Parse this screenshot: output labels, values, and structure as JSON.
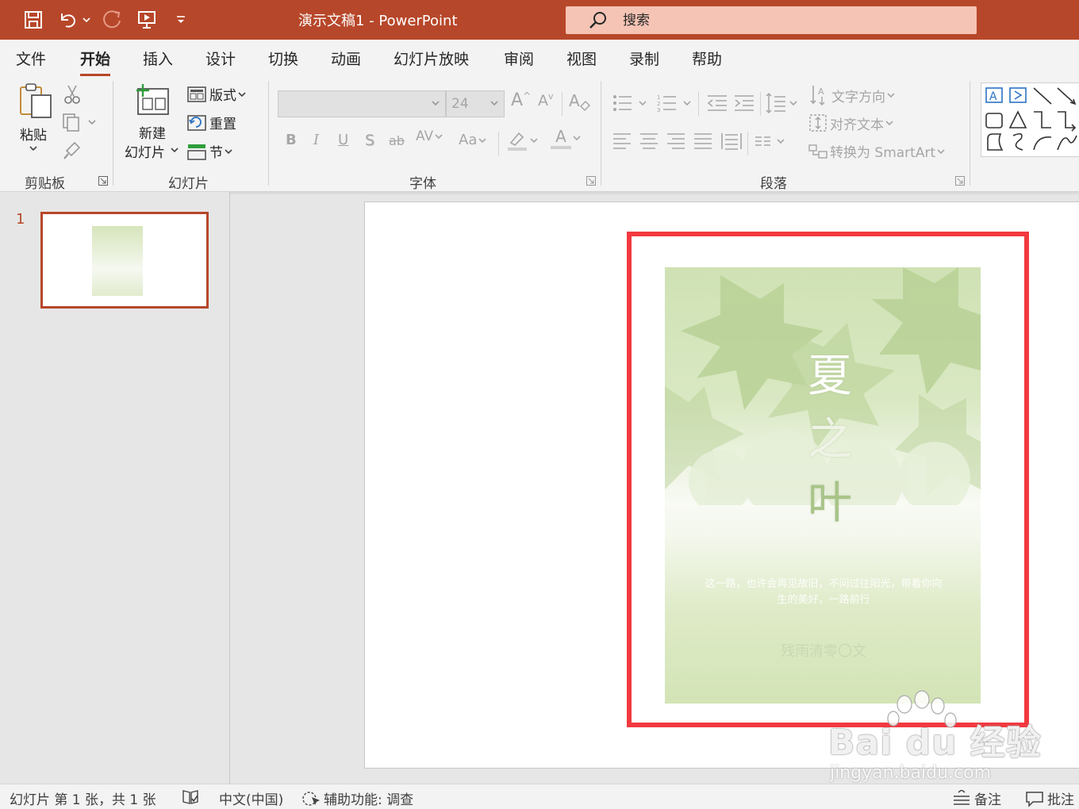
{
  "window": {
    "title": "演示文稿1  -  PowerPoint"
  },
  "search": {
    "placeholder": "搜索"
  },
  "tabs": [
    "文件",
    "开始",
    "插入",
    "设计",
    "切换",
    "动画",
    "幻灯片放映",
    "审阅",
    "视图",
    "录制",
    "帮助"
  ],
  "ribbon": {
    "clipboard": {
      "paste": "粘贴",
      "group": "剪贴板"
    },
    "slides": {
      "new_slide_1": "新建",
      "new_slide_2": "幻灯片",
      "layout": "版式",
      "reset": "重置",
      "section": "节",
      "group": "幻灯片"
    },
    "font": {
      "font_name": "",
      "font_size": "24",
      "group": "字体",
      "bold": "B",
      "italic": "I",
      "underline": "U",
      "shadow": "S",
      "strike": "ab",
      "spacing": "AV",
      "case": "Aa",
      "grow": "A",
      "shrink": "A",
      "color": "A"
    },
    "paragraph": {
      "text_direction": "文字方向",
      "align_text": "对齐文本",
      "smartart": "转换为 SmartArt",
      "group": "段落"
    }
  },
  "thumbnails": {
    "slide_number": "1"
  },
  "slide": {
    "cover_title_1": "夏",
    "cover_title_2": "之",
    "cover_title_3": "叶",
    "cover_desc": "这一路，也许会再见故旧，不问过往阳光，带着你向生的美好，一路前行",
    "cover_author": "残雨清零〇文"
  },
  "watermark": {
    "brand": "Bai du 经验",
    "url": "jingyan.baidu.com"
  },
  "status": {
    "slide_info": "幻灯片 第 1 张，共 1 张",
    "language": "中文(中国)",
    "accessibility": "辅助功能: 调查",
    "notes": "备注",
    "comments": "批注"
  },
  "colors": {
    "accent": "#b7472a",
    "highlight_box": "#f2393f"
  }
}
